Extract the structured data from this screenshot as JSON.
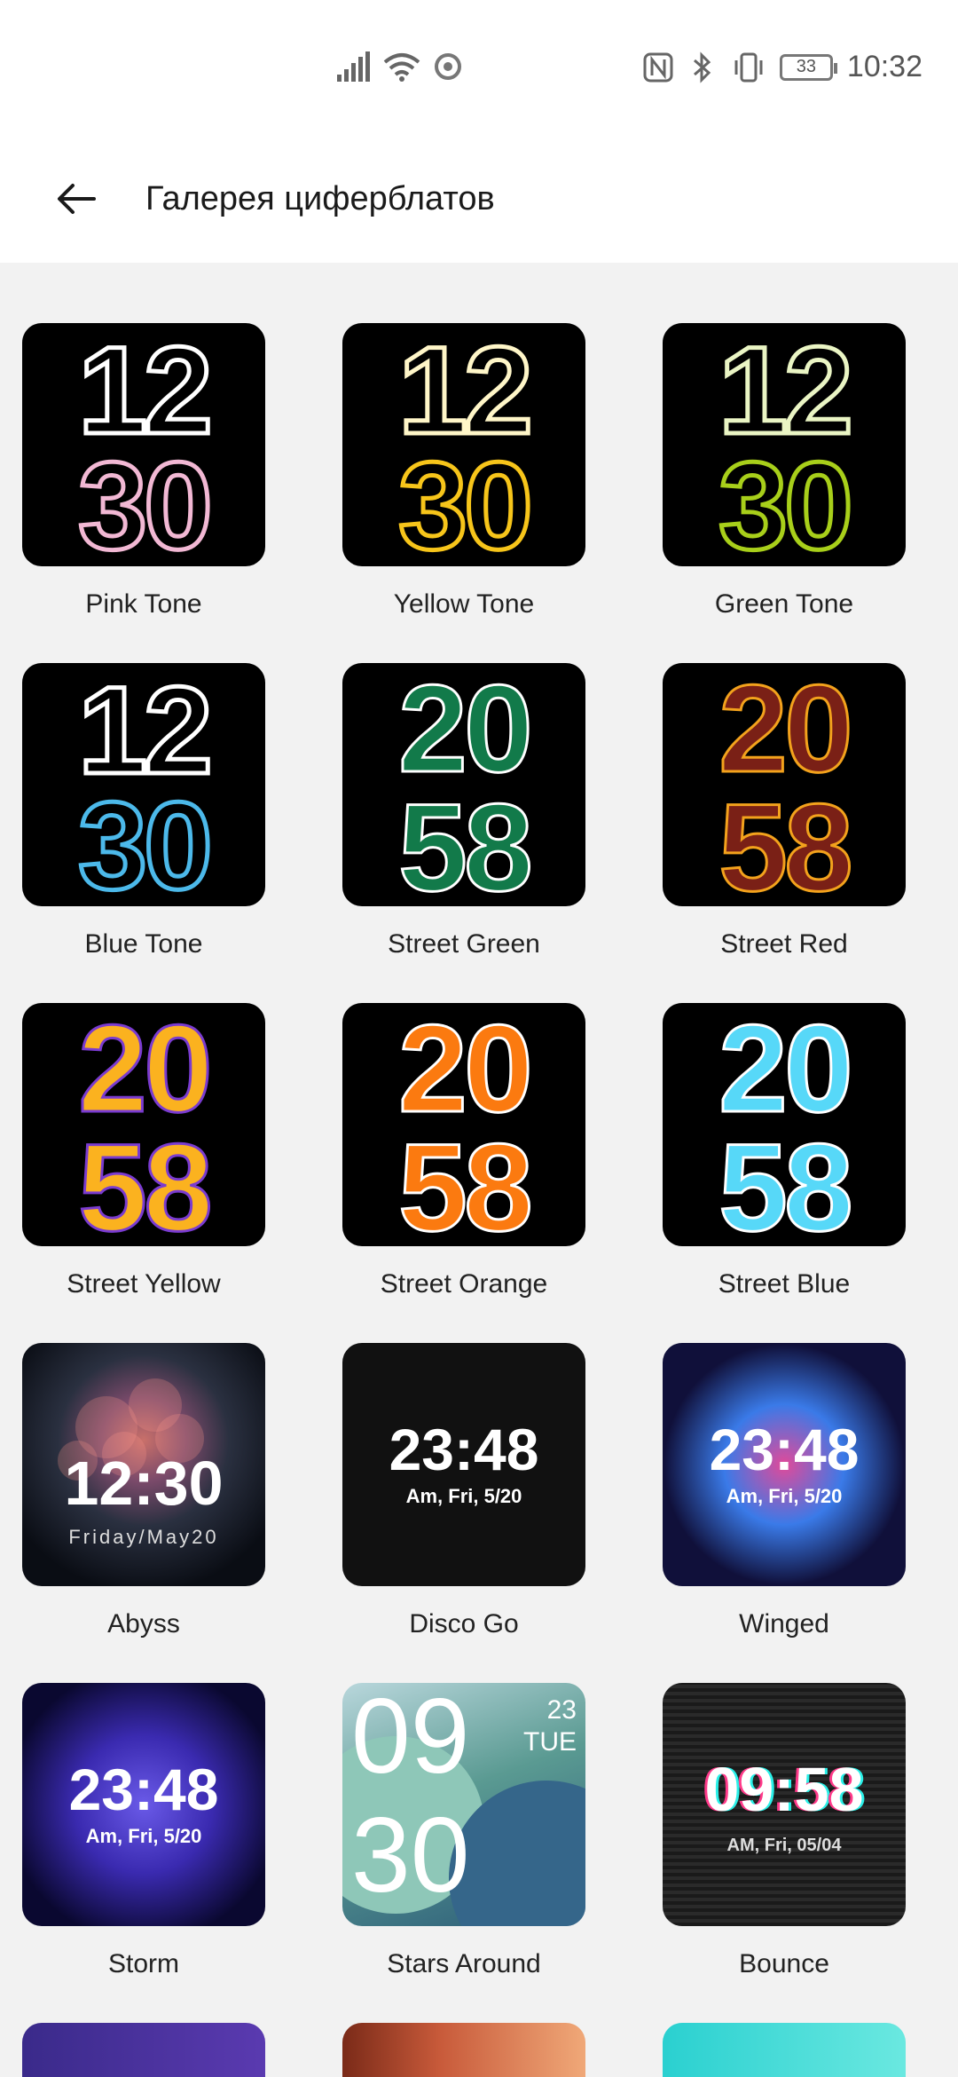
{
  "status": {
    "time": "10:32",
    "battery": "33",
    "icons": [
      "signal-icon",
      "wifi-icon",
      "sync-icon",
      "nfc-icon",
      "bluetooth-icon",
      "vibrate-icon",
      "battery-icon"
    ]
  },
  "header": {
    "back_icon": "arrow-left-icon",
    "title": "Галерея циферблатов"
  },
  "faces": [
    {
      "label": "Pink Tone",
      "style": "tone",
      "hour": "12",
      "minute": "30",
      "accent": "#f2b8d4",
      "accent2": "#ffffff"
    },
    {
      "label": "Yellow Tone",
      "style": "tone",
      "hour": "12",
      "minute": "30",
      "accent": "#f7c51a",
      "accent2": "#fff6c8"
    },
    {
      "label": "Green Tone",
      "style": "tone",
      "hour": "12",
      "minute": "30",
      "accent": "#a8cf1a",
      "accent2": "#eaf5c4"
    },
    {
      "label": "Blue Tone",
      "style": "tone",
      "hour": "12",
      "minute": "30",
      "accent": "#4cb9ea",
      "accent2": "#ffffff"
    },
    {
      "label": "Street Green",
      "style": "street",
      "hour": "20",
      "minute": "58",
      "accent": "#127a4a",
      "accent2": "#ffffff"
    },
    {
      "label": "Street Red",
      "style": "street",
      "hour": "20",
      "minute": "58",
      "accent": "#7a2016",
      "accent2": "#f3a21c"
    },
    {
      "label": "Street Yellow",
      "style": "street",
      "hour": "20",
      "minute": "58",
      "accent": "#fbb21f",
      "accent2": "#7a3bd0"
    },
    {
      "label": "Street Orange",
      "style": "street",
      "hour": "20",
      "minute": "58",
      "accent": "#fb7a10",
      "accent2": "#ffffff"
    },
    {
      "label": "Street Blue",
      "style": "street",
      "hour": "20",
      "minute": "58",
      "accent": "#57d8f8",
      "accent2": "#ffffff"
    },
    {
      "label": "Abyss",
      "style": "abyss",
      "time": "12:30",
      "date": "Friday/May20",
      "accent": "#2a3040"
    },
    {
      "label": "Disco Go",
      "style": "disco",
      "time": "23:48",
      "date": "Am, Fri, 5/20",
      "accent": "#1a1a1a"
    },
    {
      "label": "Winged",
      "style": "winged",
      "time": "23:48",
      "date": "Am, Fri, 5/20",
      "accent": "#10103a"
    },
    {
      "label": "Storm",
      "style": "storm",
      "time": "23:48",
      "date": "Am, Fri, 5/20",
      "accent": "#2a1a7a"
    },
    {
      "label": "Stars Around",
      "style": "stars",
      "hour": "09",
      "minute": "30",
      "day": "23",
      "weekday": "TUE",
      "accent": "#5a9a92"
    },
    {
      "label": "Bounce",
      "style": "bounce",
      "time": "09:58",
      "date": "AM, Fri, 05/04",
      "accent": "#1a1a1a"
    }
  ]
}
